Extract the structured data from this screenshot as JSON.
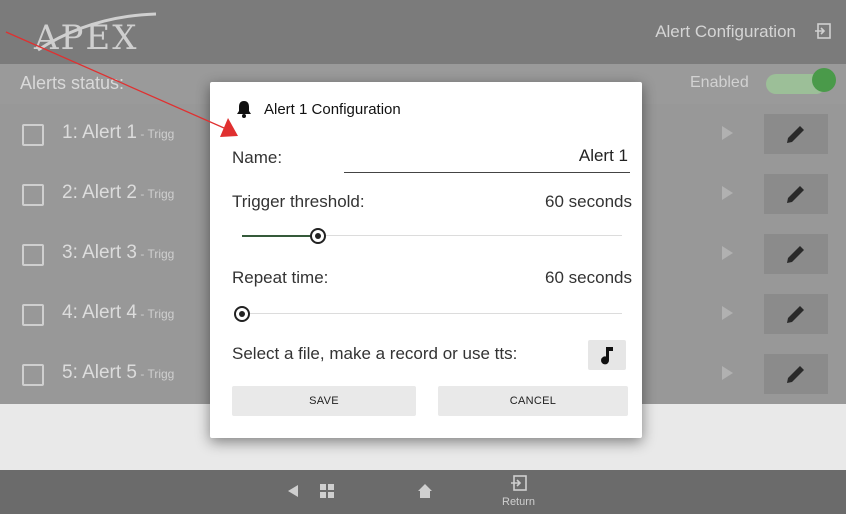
{
  "app": {
    "logo": "APEX",
    "title": "Alert Configuration"
  },
  "status": {
    "label": "Alerts status:",
    "enabled_label": "Enabled",
    "enabled": true
  },
  "alerts": [
    {
      "checked": false,
      "label": "1: Alert 1",
      "sub": " - Trigg"
    },
    {
      "checked": false,
      "label": "2: Alert 2",
      "sub": " - Trigg"
    },
    {
      "checked": false,
      "label": "3: Alert 3",
      "sub": " - Trigg"
    },
    {
      "checked": false,
      "label": "4: Alert 4",
      "sub": " - Trigg"
    },
    {
      "checked": false,
      "label": "5: Alert 5",
      "sub": " - Trigg"
    }
  ],
  "dialog": {
    "title": "Alert 1 Configuration",
    "name_label": "Name:",
    "name_value": "Alert 1",
    "trigger_label": "Trigger threshold:",
    "trigger_value": "60 seconds",
    "trigger_fraction": 0.2,
    "repeat_label": "Repeat time:",
    "repeat_value": "60 seconds",
    "repeat_fraction": 0.0,
    "file_label": "Select a file, make a record or use tts:",
    "save_label": "SAVE",
    "cancel_label": "CANCEL"
  },
  "navbar": {
    "return_label": "Return"
  },
  "colors": {
    "toggle_on": "#4a9a4a",
    "slider_fill": "#355a3a",
    "arrow": "#e03030"
  },
  "icons": {
    "bell": "bell-icon",
    "music": "music-note-icon",
    "edit": "pencil-icon",
    "play": "play-icon",
    "exit": "exit-icon"
  }
}
